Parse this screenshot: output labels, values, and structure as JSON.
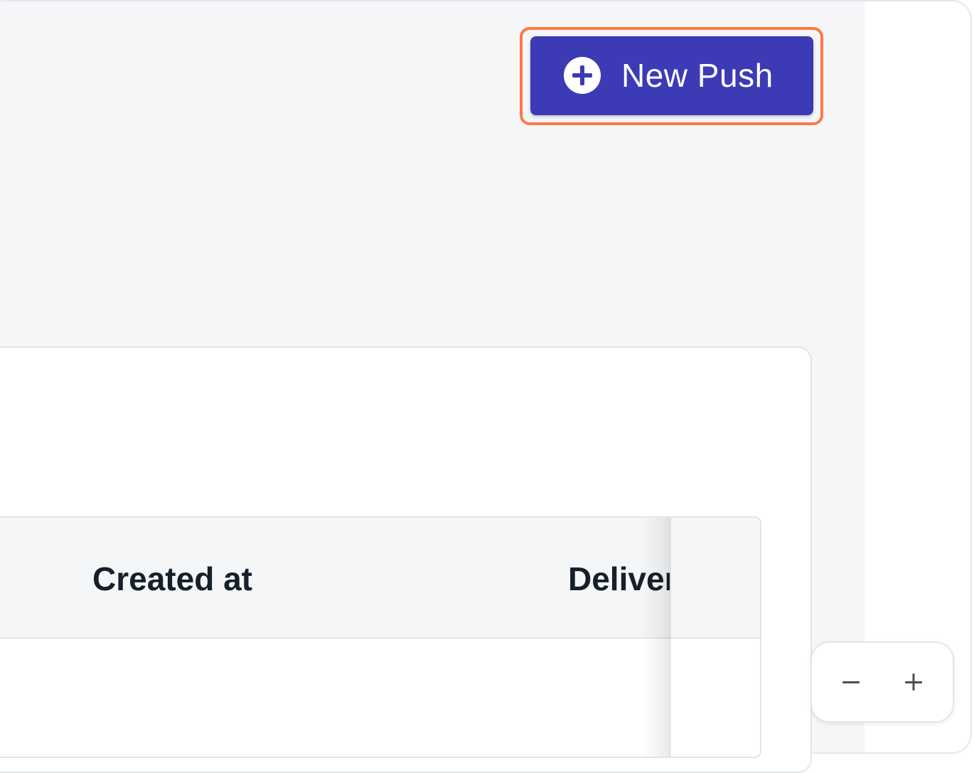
{
  "toolbar": {
    "new_push_label": "New Push",
    "new_push_icon": "plus-circle-icon",
    "highlight_color": "#ff7845",
    "button_color": "#3c3ab5"
  },
  "table": {
    "columns": [
      {
        "label": "Created at"
      },
      {
        "label": "Delivered"
      }
    ]
  },
  "zoom": {
    "out_icon": "minus-icon",
    "in_icon": "plus-icon"
  }
}
